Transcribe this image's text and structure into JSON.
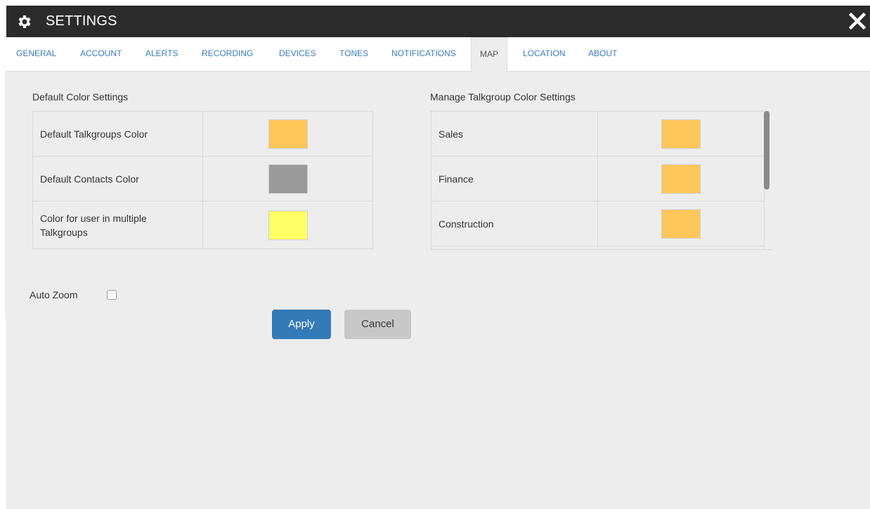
{
  "window": {
    "title": "SETTINGS",
    "icon": "gear-icon",
    "close_icon": "close-icon"
  },
  "tabs": [
    {
      "label": "GENERAL",
      "active": false
    },
    {
      "label": "ACCOUNT",
      "active": false
    },
    {
      "label": "ALERTS",
      "active": false
    },
    {
      "label": "RECORDING",
      "active": false
    },
    {
      "label": "DEVICES",
      "active": false
    },
    {
      "label": "TONES",
      "active": false
    },
    {
      "label": "NOTIFICATIONS",
      "active": false
    },
    {
      "label": "MAP",
      "active": true
    },
    {
      "label": "LOCATION",
      "active": false
    },
    {
      "label": "ABOUT",
      "active": false
    }
  ],
  "default_colors": {
    "title": "Default Color Settings",
    "rows": [
      {
        "label": "Default Talkgroups Color",
        "color": "#ffc75a"
      },
      {
        "label": "Default Contacts Color",
        "color": "#9a9a9a"
      },
      {
        "label": "Color for user in multiple Talkgroups",
        "color": "#ffff66"
      }
    ]
  },
  "talkgroup_colors": {
    "title": "Manage Talkgroup Color Settings",
    "rows": [
      {
        "label": "Sales",
        "color": "#ffc75a"
      },
      {
        "label": "Finance",
        "color": "#ffc75a"
      },
      {
        "label": "Construction",
        "color": "#ffc75a"
      }
    ]
  },
  "auto_zoom": {
    "label": "Auto Zoom",
    "checked": false
  },
  "buttons": {
    "apply": "Apply",
    "cancel": "Cancel"
  },
  "colors": {
    "titlebar": "#2b2b2b",
    "tab_link": "#3a7bbd",
    "panel": "#ededed",
    "primary": "#337ab7"
  }
}
